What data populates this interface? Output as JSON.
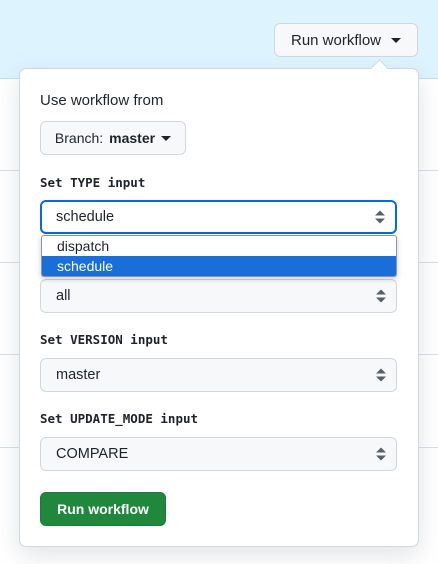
{
  "header": {
    "run_button_label": "Run workflow"
  },
  "panel": {
    "use_workflow_from_label": "Use workflow from",
    "branch_prefix": "Branch:",
    "branch_name": "master",
    "inputs": [
      {
        "label": "Set TYPE input",
        "value": "schedule"
      },
      {
        "label": "",
        "value": "all"
      },
      {
        "label": "Set VERSION input",
        "value": "master"
      },
      {
        "label": "Set UPDATE_MODE input",
        "value": "COMPARE"
      }
    ],
    "type_dropdown_options": [
      "dispatch",
      "schedule"
    ],
    "type_dropdown_selected": "schedule",
    "submit_label": "Run workflow"
  },
  "colors": {
    "header_bg": "#ddf4ff",
    "focus_border": "#0969da",
    "option_highlight": "#1a6ed8",
    "submit_bg": "#1f883d"
  },
  "icons": [
    "caret-down-icon",
    "select-updown-icon"
  ]
}
